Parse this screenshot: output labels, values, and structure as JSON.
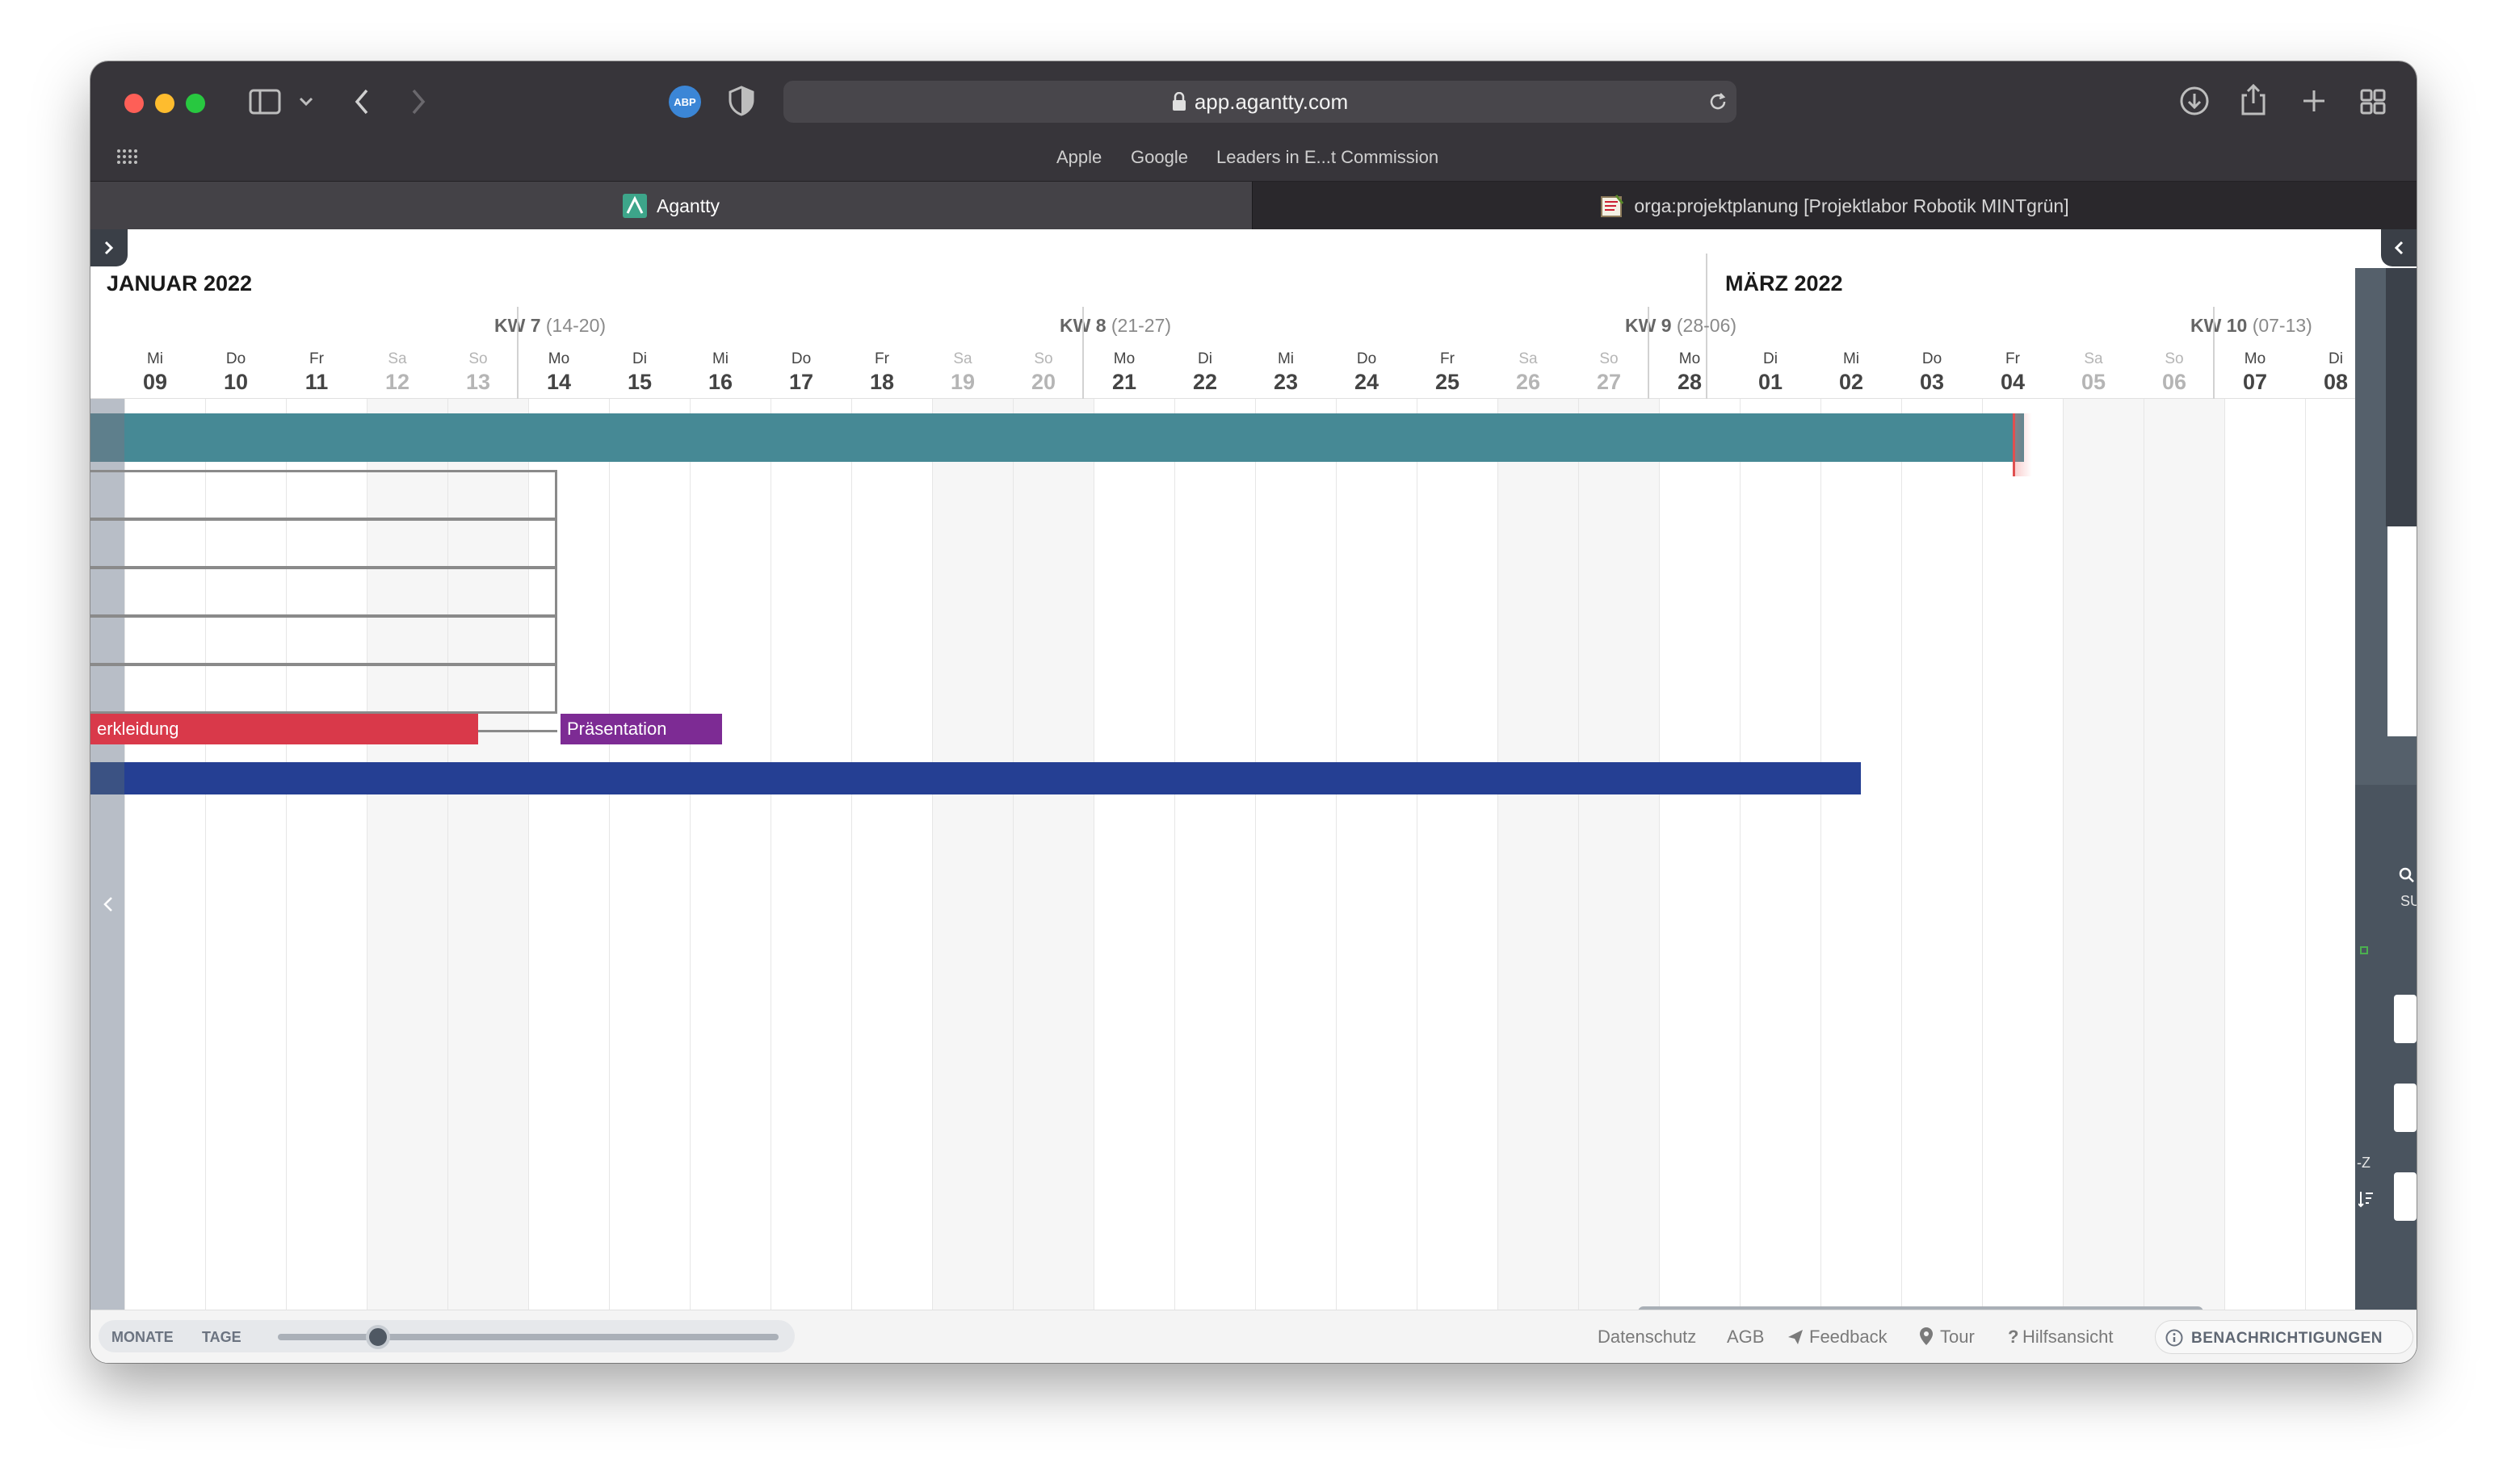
{
  "browser": {
    "url": "app.agantty.com",
    "bookmarks": [
      "Apple",
      "Google",
      "Leaders in E...t Commission"
    ],
    "tabs": [
      {
        "label": "Agantty",
        "active": true
      },
      {
        "label": "orga:projektplanung [Projektlabor Robotik MINTgrün]",
        "active": false
      }
    ],
    "abp_badge": "ABP"
  },
  "timeline": {
    "months": [
      {
        "label": "JANUAR 2022"
      },
      {
        "label": "MÄRZ 2022"
      }
    ],
    "weeks": [
      {
        "label": "KW 7",
        "range": "(14-20)"
      },
      {
        "label": "KW 8",
        "range": "(21-27)"
      },
      {
        "label": "KW 9",
        "range": "(28-06)"
      },
      {
        "label": "KW 10",
        "range": "(07-13)"
      }
    ],
    "days": [
      {
        "wd": "Mi",
        "dn": "09",
        "weekend": false
      },
      {
        "wd": "Do",
        "dn": "10",
        "weekend": false
      },
      {
        "wd": "Fr",
        "dn": "11",
        "weekend": false
      },
      {
        "wd": "Sa",
        "dn": "12",
        "weekend": true
      },
      {
        "wd": "So",
        "dn": "13",
        "weekend": true
      },
      {
        "wd": "Mo",
        "dn": "14",
        "weekend": false
      },
      {
        "wd": "Di",
        "dn": "15",
        "weekend": false
      },
      {
        "wd": "Mi",
        "dn": "16",
        "weekend": false
      },
      {
        "wd": "Do",
        "dn": "17",
        "weekend": false
      },
      {
        "wd": "Fr",
        "dn": "18",
        "weekend": false
      },
      {
        "wd": "Sa",
        "dn": "19",
        "weekend": true
      },
      {
        "wd": "So",
        "dn": "20",
        "weekend": true
      },
      {
        "wd": "Mo",
        "dn": "21",
        "weekend": false
      },
      {
        "wd": "Di",
        "dn": "22",
        "weekend": false
      },
      {
        "wd": "Mi",
        "dn": "23",
        "weekend": false
      },
      {
        "wd": "Do",
        "dn": "24",
        "weekend": false
      },
      {
        "wd": "Fr",
        "dn": "25",
        "weekend": false
      },
      {
        "wd": "Sa",
        "dn": "26",
        "weekend": true
      },
      {
        "wd": "So",
        "dn": "27",
        "weekend": true
      },
      {
        "wd": "Mo",
        "dn": "28",
        "weekend": false
      },
      {
        "wd": "Di",
        "dn": "01",
        "weekend": false
      },
      {
        "wd": "Mi",
        "dn": "02",
        "weekend": false
      },
      {
        "wd": "Do",
        "dn": "03",
        "weekend": false
      },
      {
        "wd": "Fr",
        "dn": "04",
        "weekend": false
      },
      {
        "wd": "Sa",
        "dn": "05",
        "weekend": true
      },
      {
        "wd": "So",
        "dn": "06",
        "weekend": true
      },
      {
        "wd": "Mo",
        "dn": "07",
        "weekend": false
      },
      {
        "wd": "Di",
        "dn": "08",
        "weekend": false
      }
    ],
    "tasks": {
      "verkleidung": "erkleidung",
      "praesentation": "Präsentation"
    },
    "colors": {
      "teal": "#468995",
      "red": "#d9394a",
      "purple": "#7d2b94",
      "blue": "#253f93"
    }
  },
  "footer": {
    "zoom_months": "MONATE",
    "zoom_days": "TAGE",
    "zoom_level": 0.2,
    "links": {
      "datenschutz": "Datenschutz",
      "agb": "AGB",
      "feedback": "Feedback",
      "tour": "Tour",
      "hilfsansicht": "Hilfsansicht",
      "benachrichtigungen": "BENACHRICHTIGUNGEN"
    }
  },
  "sidebar": {
    "search_label": "SU",
    "sort_label": "-Z"
  }
}
